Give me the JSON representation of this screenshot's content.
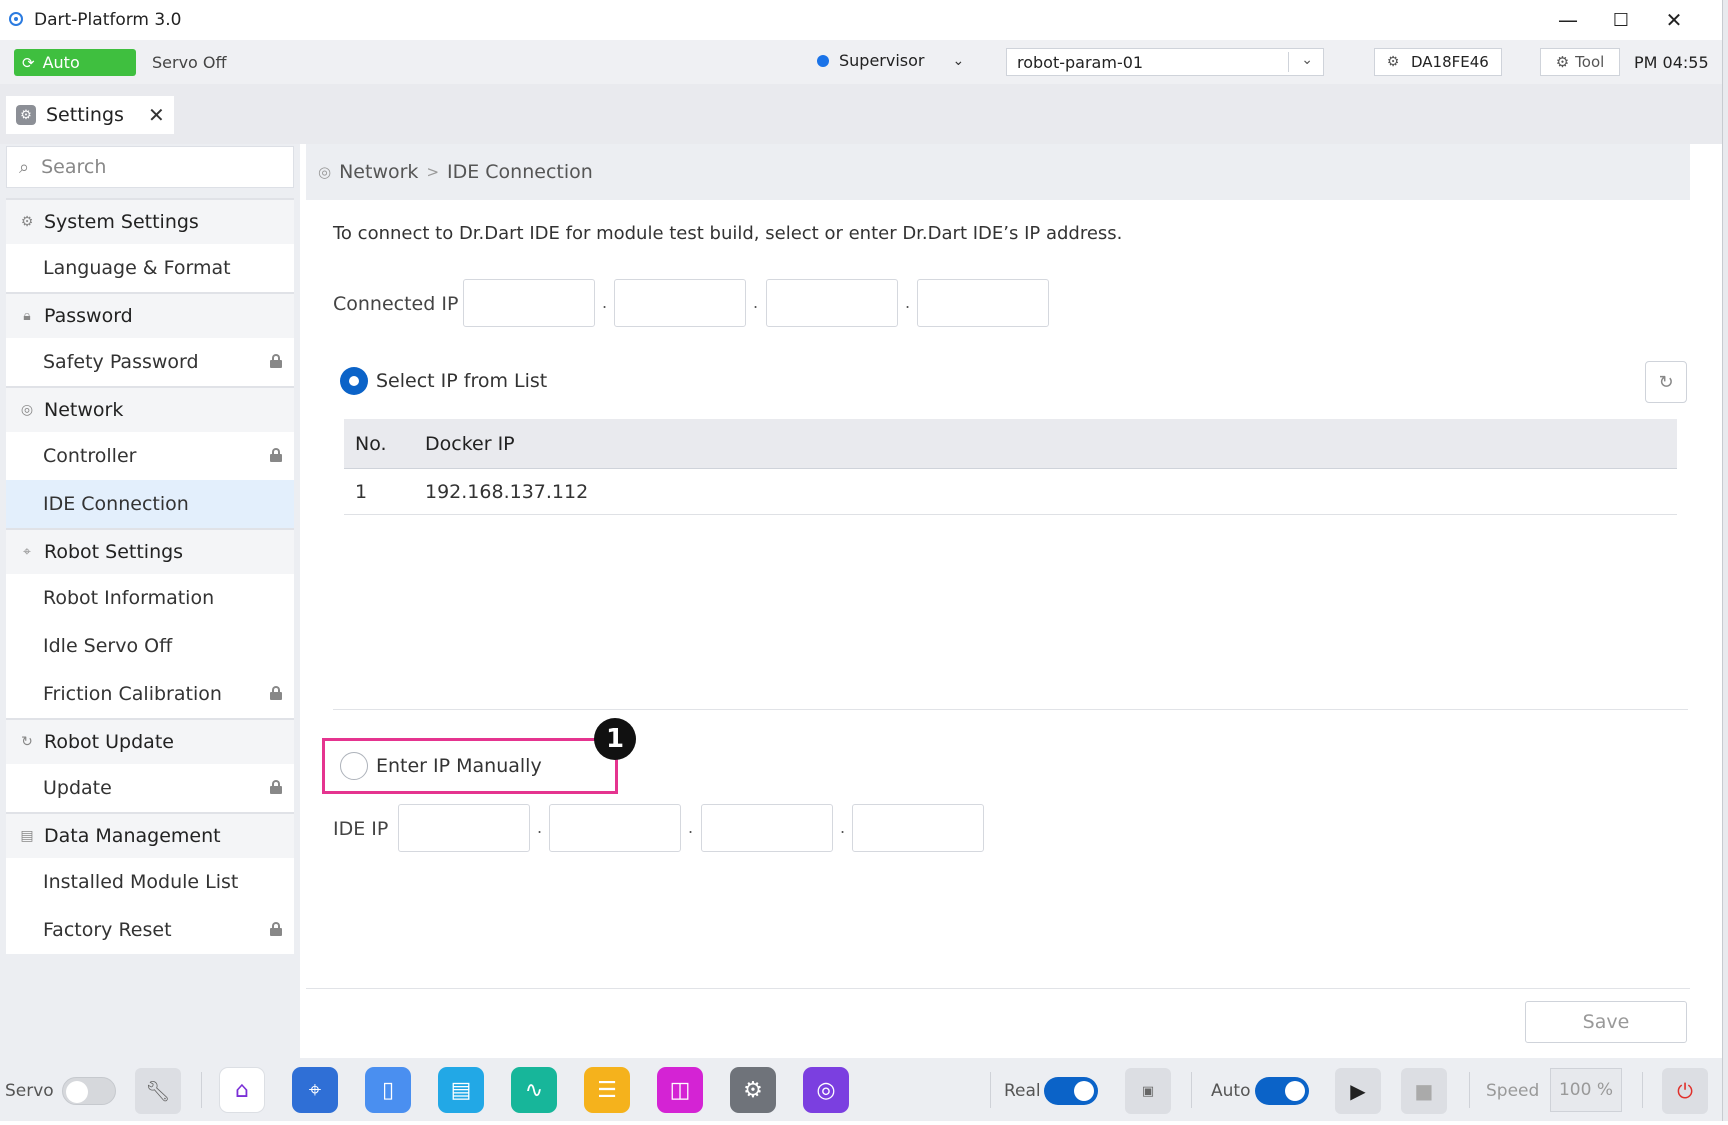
{
  "window": {
    "title": "Dart-Platform 3.0",
    "minimize": "—",
    "maximize": "☐",
    "close": "✕"
  },
  "status": {
    "mode": "Auto",
    "servo": "Servo Off",
    "role": "Supervisor",
    "param": "robot-param-01",
    "device": "DA18FE46",
    "tool": "Tool",
    "time": "PM 04:55"
  },
  "tab": {
    "label": "Settings"
  },
  "sidebar": {
    "search_placeholder": "Search",
    "groups": [
      {
        "label": "System Settings",
        "items": [
          {
            "label": "Language & Format",
            "locked": false
          }
        ]
      },
      {
        "label": "Password",
        "items": [
          {
            "label": "Safety Password",
            "locked": true
          }
        ]
      },
      {
        "label": "Network",
        "items": [
          {
            "label": "Controller",
            "locked": true
          },
          {
            "label": "IDE Connection",
            "locked": false,
            "active": true
          }
        ]
      },
      {
        "label": "Robot Settings",
        "items": [
          {
            "label": "Robot Information",
            "locked": false
          },
          {
            "label": "Idle Servo Off",
            "locked": false
          },
          {
            "label": "Friction Calibration",
            "locked": true
          }
        ]
      },
      {
        "label": "Robot Update",
        "items": [
          {
            "label": "Update",
            "locked": true
          }
        ]
      },
      {
        "label": "Data Management",
        "items": [
          {
            "label": "Installed Module List",
            "locked": false
          },
          {
            "label": "Factory Reset",
            "locked": true
          }
        ]
      }
    ]
  },
  "main": {
    "breadcrumb": {
      "parent": "Network",
      "separator": ">",
      "current": "IDE Connection"
    },
    "description": "To connect to Dr.Dart IDE for module test build, select or enter Dr.Dart IDE’s IP address.",
    "connected_ip_label": "Connected IP",
    "select_list_label": "Select IP from List",
    "table": {
      "headers": [
        "No.",
        "Docker IP"
      ],
      "rows": [
        [
          "1",
          "192.168.137.112"
        ]
      ]
    },
    "manual_label": "Enter IP Manually",
    "ide_ip_label": "IDE IP",
    "callout": "1",
    "save_label": "Save"
  },
  "dock": {
    "servo_label": "Servo",
    "real_label": "Real",
    "auto_label": "Auto",
    "speed_label": "Speed",
    "speed_value": "100 %"
  },
  "colors": {
    "accent": "#0b63c8",
    "auto_green": "#3fbf3f",
    "highlight_pink": "#e5348f"
  }
}
